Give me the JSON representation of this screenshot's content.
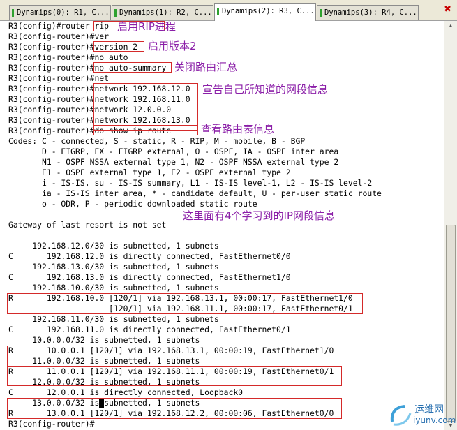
{
  "tabs": [
    {
      "label": "Dynamips(0): R1, C...",
      "active": false
    },
    {
      "label": "Dynamips(1): R2, C...",
      "active": false
    },
    {
      "label": "Dynamips(2): R3, C...",
      "active": true
    },
    {
      "label": "Dynamips(3): R4, C...",
      "active": false
    }
  ],
  "close_symbol": "✖",
  "terminal": {
    "lines": [
      "R3(config)#router rip",
      "R3(config-router)#ver",
      "R3(config-router)#version 2",
      "R3(config-router)#no auto",
      "R3(config-router)#no auto-summary",
      "R3(config-router)#net",
      "R3(config-router)#network 192.168.12.0",
      "R3(config-router)#network 192.168.11.0",
      "R3(config-router)#network 12.0.0.0",
      "R3(config-router)#network 192.168.13.0",
      "R3(config-router)#do show ip route",
      "Codes: C - connected, S - static, R - RIP, M - mobile, B - BGP",
      "       D - EIGRP, EX - EIGRP external, O - OSPF, IA - OSPF inter area",
      "       N1 - OSPF NSSA external type 1, N2 - OSPF NSSA external type 2",
      "       E1 - OSPF external type 1, E2 - OSPF external type 2",
      "       i - IS-IS, su - IS-IS summary, L1 - IS-IS level-1, L2 - IS-IS level-2",
      "       ia - IS-IS inter area, * - candidate default, U - per-user static route",
      "       o - ODR, P - periodic downloaded static route",
      "",
      "Gateway of last resort is not set",
      "",
      "     192.168.12.0/30 is subnetted, 1 subnets",
      "C       192.168.12.0 is directly connected, FastEthernet0/0",
      "     192.168.13.0/30 is subnetted, 1 subnets",
      "C       192.168.13.0 is directly connected, FastEthernet1/0",
      "     192.168.10.0/30 is subnetted, 1 subnets",
      "R       192.168.10.0 [120/1] via 192.168.13.1, 00:00:17, FastEthernet1/0",
      "                     [120/1] via 192.168.11.1, 00:00:17, FastEthernet0/1",
      "     192.168.11.0/30 is subnetted, 1 subnets",
      "C       192.168.11.0 is directly connected, FastEthernet0/1",
      "     10.0.0.0/32 is subnetted, 1 subnets",
      "R       10.0.0.1 [120/1] via 192.168.13.1, 00:00:19, FastEthernet1/0",
      "     11.0.0.0/32 is subnetted, 1 subnets",
      "R       11.0.0.1 [120/1] via 192.168.11.1, 00:00:19, FastEthernet0/1",
      "     12.0.0.0/32 is subnetted, 1 subnets",
      "C       12.0.0.1 is directly connected, Loopback0",
      "     13.0.0.0/32 is subnetted, 1 subnets",
      "R       13.0.0.1 [120/1] via 192.168.12.2, 00:00:06, FastEthernet0/0",
      "R3(config-router)#"
    ]
  },
  "annotations": {
    "enable_rip": "启用RIP进程",
    "enable_v2": "启用版本2",
    "disable_summary": "关闭路由汇总",
    "announce_networks": "宣告自己所知道的网段信息",
    "show_route": "查看路由表信息",
    "learned_routes": "这里面有4个学习到的IP网段信息"
  },
  "watermark": {
    "name_cn": "运维网",
    "domain": "iyunv.com"
  }
}
